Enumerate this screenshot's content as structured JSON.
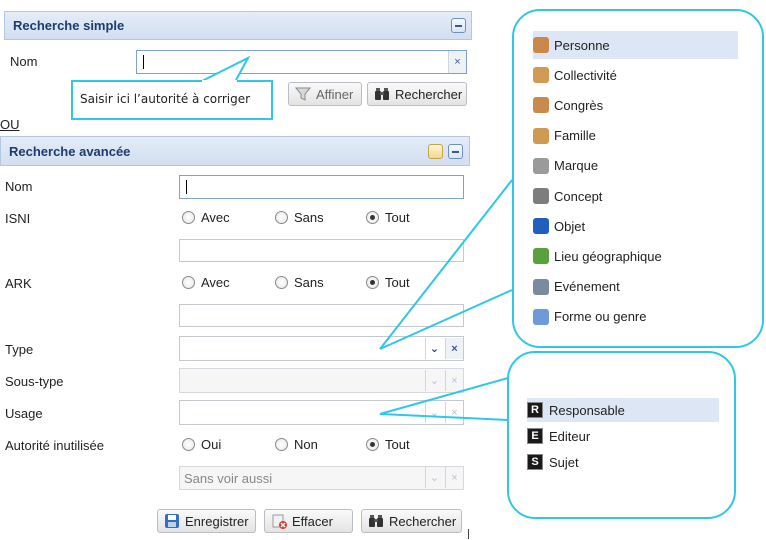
{
  "simple": {
    "title": "Recherche simple",
    "nom_label": "Nom",
    "nom_value": "",
    "clear_glyph": "×",
    "affiner_label": "Affiner",
    "rechercher_label": "Rechercher"
  },
  "tooltip": {
    "text": "Saisir ici l’autorité à corriger"
  },
  "or_text": "OU",
  "advanced": {
    "title": "Recherche avancée",
    "nom_label": "Nom",
    "isni_label": "ISNI",
    "ark_label": "ARK",
    "type_label": "Type",
    "soustype_label": "Sous-type",
    "usage_label": "Usage",
    "inutilisee_label": "Autorité inutilisée",
    "opt_avec": "Avec",
    "opt_sans": "Sans",
    "opt_tout": "Tout",
    "opt_oui": "Oui",
    "opt_non": "Non",
    "sans_voir_aussi": "Sans voir aussi",
    "dropdown_glyph": "⌄",
    "clear_glyph": "×",
    "enregistrer_label": "Enregistrer",
    "effacer_label": "Effacer",
    "rechercher_label": "Rechercher"
  },
  "type_list": [
    {
      "label": "Personne",
      "icon": "person-icon",
      "color": "#c8894a",
      "selected": true
    },
    {
      "label": "Collectivité",
      "icon": "group-icon",
      "color": "#d19a55",
      "selected": false
    },
    {
      "label": "Congrès",
      "icon": "congress-icon",
      "color": "#c98a4d",
      "selected": false
    },
    {
      "label": "Famille",
      "icon": "family-icon",
      "color": "#cf9a52",
      "selected": false
    },
    {
      "label": "Marque",
      "icon": "tag-icon",
      "color": "#9a9a9a",
      "selected": false
    },
    {
      "label": "Concept",
      "icon": "gear-icon",
      "color": "#7d7d7d",
      "selected": false
    },
    {
      "label": "Objet",
      "icon": "object-icon",
      "color": "#1f5fbf",
      "selected": false
    },
    {
      "label": "Lieu géographique",
      "icon": "globe-icon",
      "color": "#5aa03c",
      "selected": false
    },
    {
      "label": "Evénement",
      "icon": "calendar-icon",
      "color": "#7c8aa0",
      "selected": false
    },
    {
      "label": "Forme ou genre",
      "icon": "document-icon",
      "color": "#6d9ad8",
      "selected": false
    }
  ],
  "usage_list": [
    {
      "badge": "R",
      "label": "Responsable",
      "selected": true
    },
    {
      "badge": "E",
      "label": "Editeur",
      "selected": false
    },
    {
      "badge": "S",
      "label": "Sujet",
      "selected": false
    }
  ],
  "colors": {
    "callout": "#2ec7e8",
    "header_bg": "#d8e3f2",
    "header_text": "#1e3b6b",
    "selected_row": "#dde6f4"
  }
}
